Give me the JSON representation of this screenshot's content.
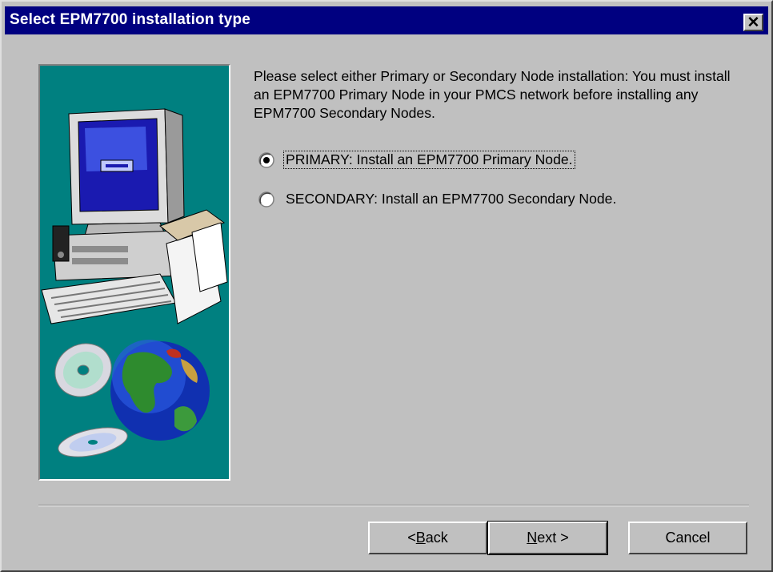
{
  "window": {
    "title": "Select EPM7700 installation type",
    "close_label": "✕"
  },
  "content": {
    "description": "Please select either Primary or Secondary Node installation: You must install an EPM7700  Primary Node in your PMCS network before installing any EPM7700 Secondary Nodes.",
    "options": [
      {
        "label": "PRIMARY: Install an EPM7700 Primary Node.",
        "selected": true
      },
      {
        "label": "SECONDARY: Install an EPM7700 Secondary Node.",
        "selected": false
      }
    ]
  },
  "buttons": {
    "back": {
      "prefix": "< ",
      "mnemonic": "B",
      "rest": "ack"
    },
    "next": {
      "mnemonic": "N",
      "rest": "ext >"
    },
    "cancel": "Cancel"
  },
  "colors": {
    "titlebar": "#000080",
    "face": "#c0c0c0",
    "art_background": "#008080"
  },
  "icons": [
    "close-icon",
    "computer-illustration",
    "globe-illustration",
    "cd-illustration"
  ]
}
